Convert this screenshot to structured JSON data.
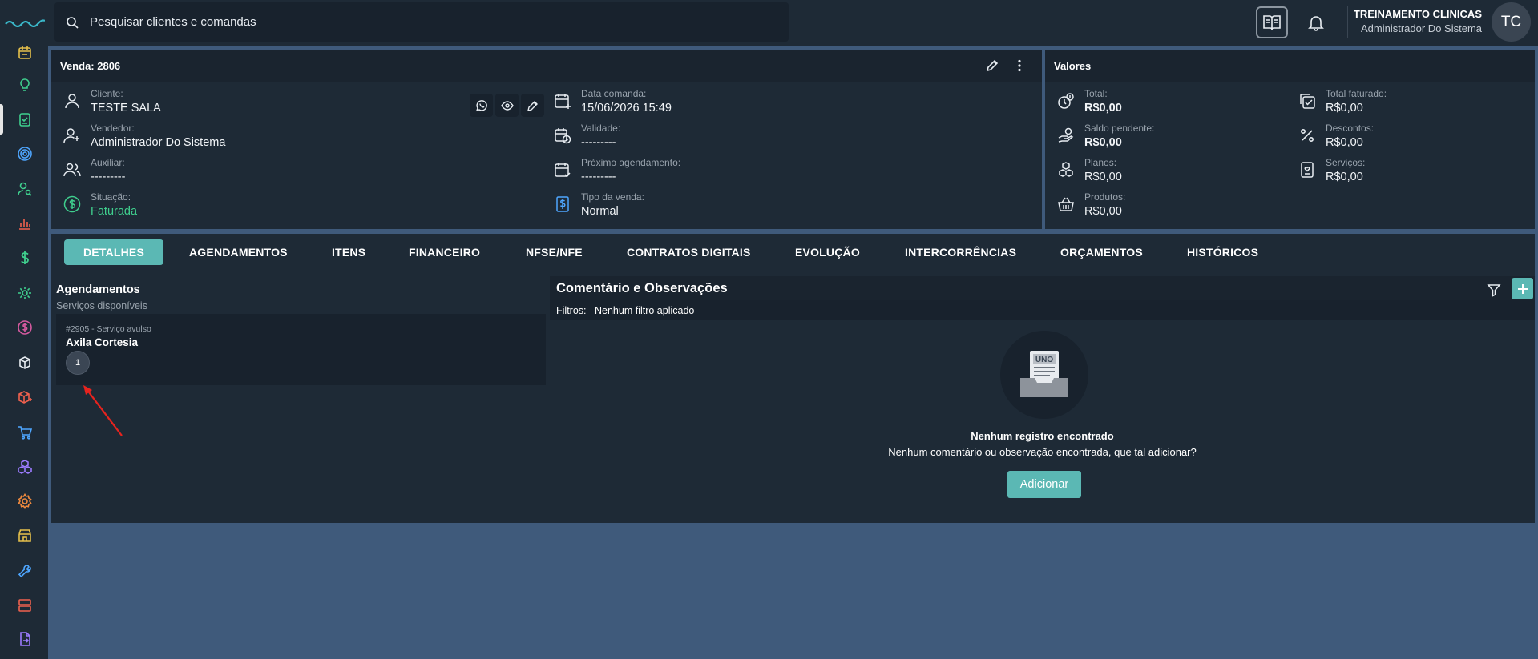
{
  "search": {
    "placeholder": "Pesquisar clientes e comandas"
  },
  "user": {
    "name": "TREINAMENTO CLINICAS",
    "role": "Administrador Do Sistema",
    "initials": "TC"
  },
  "sidebar": {
    "icons": [
      {
        "name": "calendar-list-icon",
        "color": "#e5c04b"
      },
      {
        "name": "lightbulb-icon",
        "color": "#3fcf8e"
      },
      {
        "name": "clipboard-check-icon",
        "color": "#3fcf8e"
      },
      {
        "name": "target-icon",
        "color": "#4ea6ff"
      },
      {
        "name": "user-search-icon",
        "color": "#3fcf8e"
      },
      {
        "name": "chart-bar-icon",
        "color": "#f0614e"
      },
      {
        "name": "dollar-icon",
        "color": "#3fcf8e"
      },
      {
        "name": "gear-flow-icon",
        "color": "#3fcf8e"
      },
      {
        "name": "coin-icon",
        "color": "#d65aa0"
      },
      {
        "name": "box-stack-icon",
        "color": "#e8edf2"
      },
      {
        "name": "box-plus-icon",
        "color": "#f0614e"
      },
      {
        "name": "cart-icon",
        "color": "#4ea6ff"
      },
      {
        "name": "cubes-icon",
        "color": "#9b7bff"
      },
      {
        "name": "gear-icon",
        "color": "#f08a3e"
      },
      {
        "name": "store-icon",
        "color": "#e5c04b"
      },
      {
        "name": "wrench-icon",
        "color": "#4ea6ff"
      },
      {
        "name": "server-icon",
        "color": "#f0614e"
      },
      {
        "name": "document-export-icon",
        "color": "#9b7bff"
      }
    ]
  },
  "sale": {
    "title": "Venda: 2806",
    "cliente_label": "Cliente:",
    "cliente_value": "TESTE SALA",
    "vendedor_label": "Vendedor:",
    "vendedor_value": "Administrador Do Sistema",
    "auxiliar_label": "Auxiliar:",
    "auxiliar_value": "---------",
    "situacao_label": "Situação:",
    "situacao_value": "Faturada",
    "data_label": "Data comanda:",
    "data_value": "15/06/2026 15:49",
    "validade_label": "Validade:",
    "validade_value": "---------",
    "proximo_label": "Próximo agendamento:",
    "proximo_value": "---------",
    "tipo_label": "Tipo da venda:",
    "tipo_value": "Normal"
  },
  "values": {
    "title": "Valores",
    "total_label": "Total:",
    "total_value": "R$0,00",
    "saldo_label": "Saldo pendente:",
    "saldo_value": "R$0,00",
    "planos_label": "Planos:",
    "planos_value": "R$0,00",
    "produtos_label": "Produtos:",
    "produtos_value": "R$0,00",
    "faturado_label": "Total faturado:",
    "faturado_value": "R$0,00",
    "descontos_label": "Descontos:",
    "descontos_value": "R$0,00",
    "servicos_label": "Serviços:",
    "servicos_value": "R$0,00"
  },
  "tabs": [
    "DETALHES",
    "AGENDAMENTOS",
    "ITENS",
    "FINANCEIRO",
    "NFSE/NFE",
    "CONTRATOS DIGITAIS",
    "EVOLUÇÃO",
    "INTERCORRÊNCIAS",
    "ORÇAMENTOS",
    "HISTÓRICOS"
  ],
  "schedule": {
    "title": "Agendamentos",
    "subtitle": "Serviços disponíveis",
    "service_code": "#2905 - Serviço avulso",
    "service_name": "Axila Cortesia",
    "service_count": "1"
  },
  "comments": {
    "title": "Comentário e Observações",
    "filter_label": "Filtros:",
    "filter_value": "Nenhum filtro aplicado",
    "illustration_text": "UNO",
    "empty_title": "Nenhum registro encontrado",
    "empty_sub": "Nenhum comentário ou observação encontrada, que tal adicionar?",
    "add_label": "Adicionar"
  },
  "colors": {
    "accent": "#5bb8b4",
    "success": "#3fcf8e",
    "panel": "#1e2a36",
    "background": "#3f5a7b"
  }
}
